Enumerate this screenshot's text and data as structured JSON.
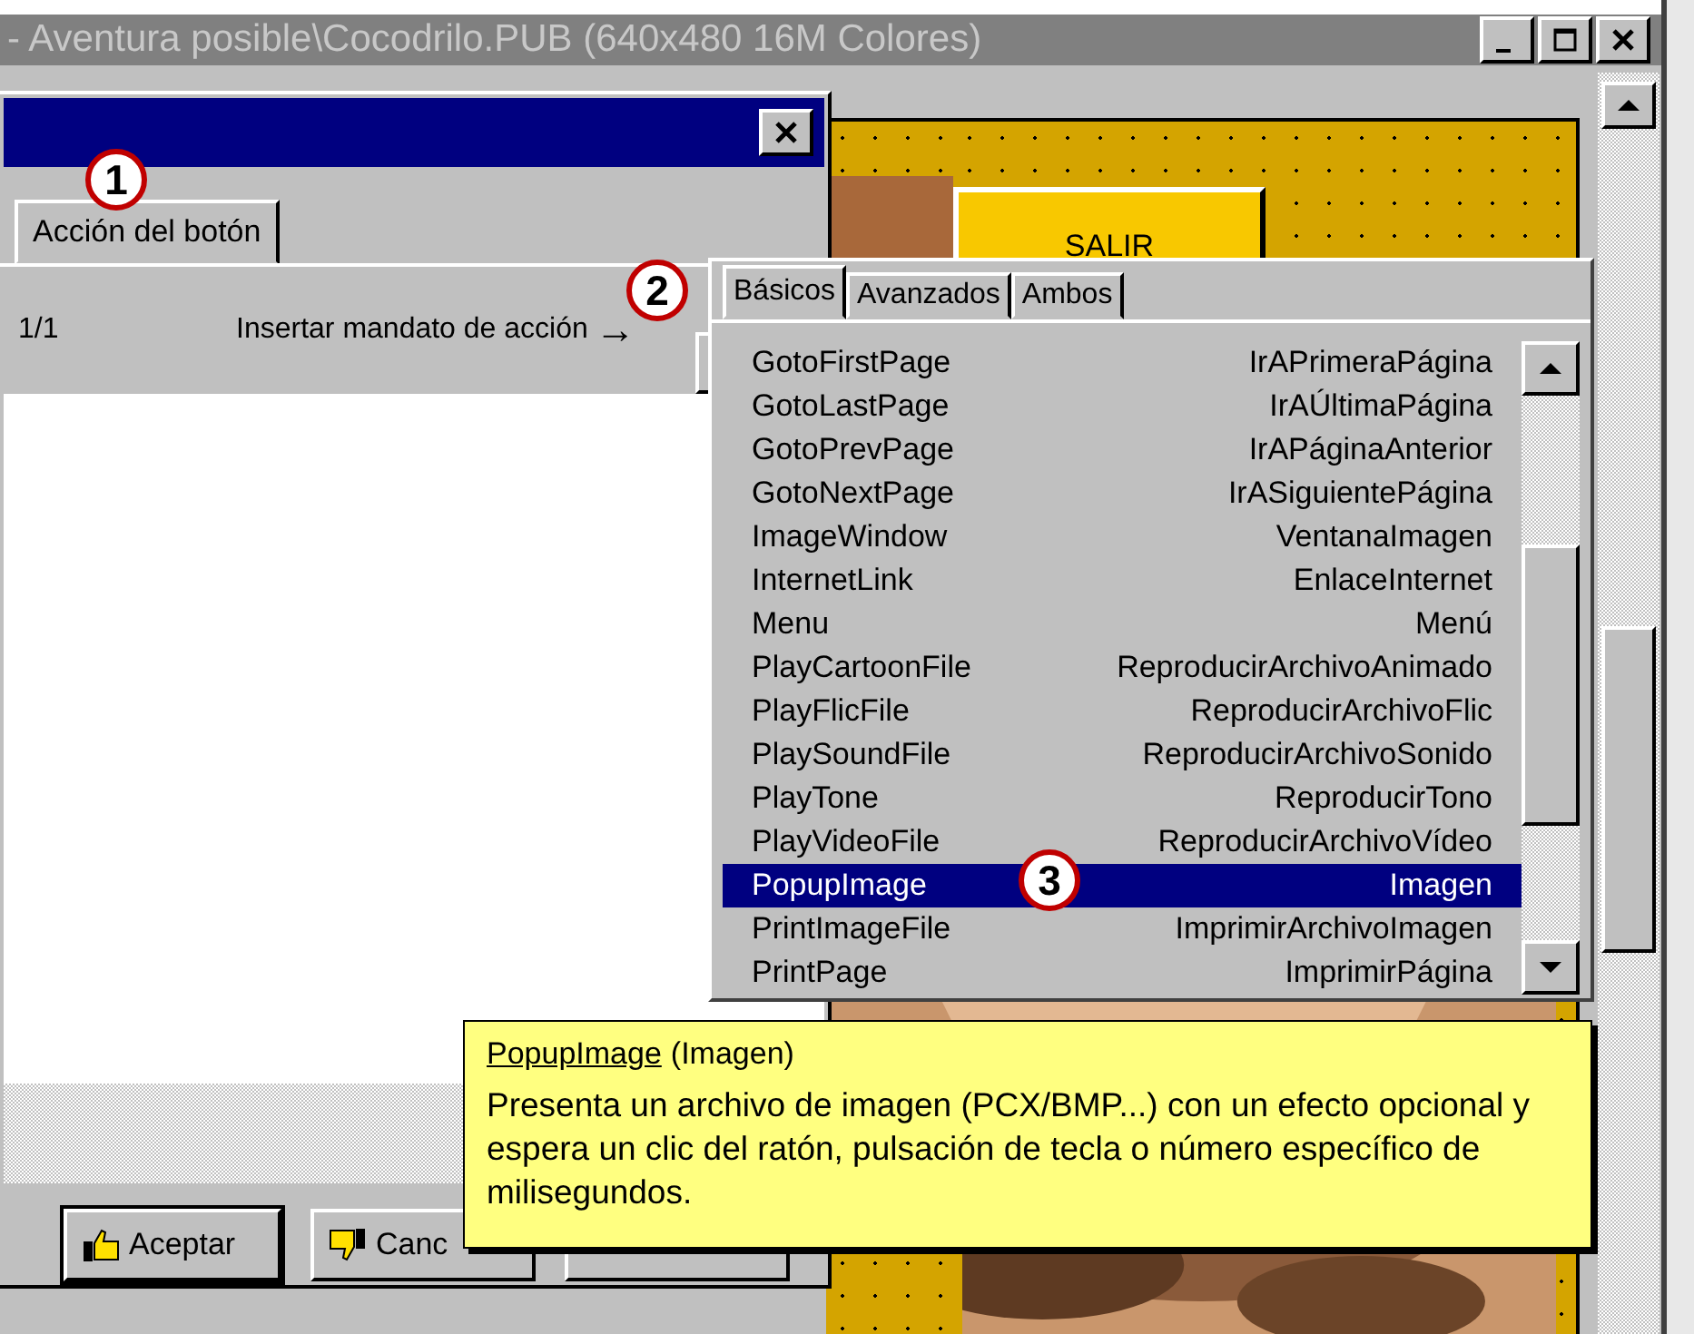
{
  "window": {
    "title": "- Aventura posible\\Cocodrilo.PUB (640x480 16M Colores)"
  },
  "page": {
    "button_label": "SALIR"
  },
  "dialog": {
    "tabs": [
      {
        "label": "Acción del botón",
        "selected": true
      }
    ],
    "page_counter": "1/1",
    "insert_label": "Insertar mandato de acción",
    "arrow": "→",
    "buttons": [
      {
        "label": "Aceptar",
        "kind": "accept"
      },
      {
        "label": "Canc",
        "kind": "cancel"
      },
      {
        "kind": "plain"
      }
    ]
  },
  "command_popup": {
    "tabs": [
      {
        "label": "Básicos",
        "selected": true
      },
      {
        "label": "Avanzados",
        "selected": false
      },
      {
        "label": "Ambos",
        "selected": false
      }
    ],
    "items": [
      {
        "name": "GotoFirstPage",
        "translation": "IrAPrimeraPágina",
        "selected": false
      },
      {
        "name": "GotoLastPage",
        "translation": "IrAÚltimaPágina",
        "selected": false
      },
      {
        "name": "GotoPrevPage",
        "translation": "IrAPáginaAnterior",
        "selected": false
      },
      {
        "name": "GotoNextPage",
        "translation": "IrASiguientePágina",
        "selected": false
      },
      {
        "name": "ImageWindow",
        "translation": "VentanaImagen",
        "selected": false
      },
      {
        "name": "InternetLink",
        "translation": "EnlaceInternet",
        "selected": false
      },
      {
        "name": "Menu",
        "translation": "Menú",
        "selected": false
      },
      {
        "name": "PlayCartoonFile",
        "translation": "ReproducirArchivoAnimado",
        "selected": false
      },
      {
        "name": "PlayFlicFile",
        "translation": "ReproducirArchivoFlic",
        "selected": false
      },
      {
        "name": "PlaySoundFile",
        "translation": "ReproducirArchivoSonido",
        "selected": false
      },
      {
        "name": "PlayTone",
        "translation": "ReproducirTono",
        "selected": false
      },
      {
        "name": "PlayVideoFile",
        "translation": "ReproducirArchivoVídeo",
        "selected": false
      },
      {
        "name": "PopupImage",
        "translation": "Imagen",
        "selected": true
      },
      {
        "name": "PrintImageFile",
        "translation": "ImprimirArchivoImagen",
        "selected": false
      },
      {
        "name": "PrintPage",
        "translation": "ImprimirPágina",
        "selected": false
      }
    ]
  },
  "tooltip": {
    "command": "PopupImage",
    "translation": "(Imagen)",
    "description": "Presenta un archivo de imagen (PCX/BMP...) con un efecto opcional y espera un clic del ratón, pulsación de tecla o número específico de milisegundos."
  },
  "callouts": [
    "1",
    "2",
    "3"
  ]
}
